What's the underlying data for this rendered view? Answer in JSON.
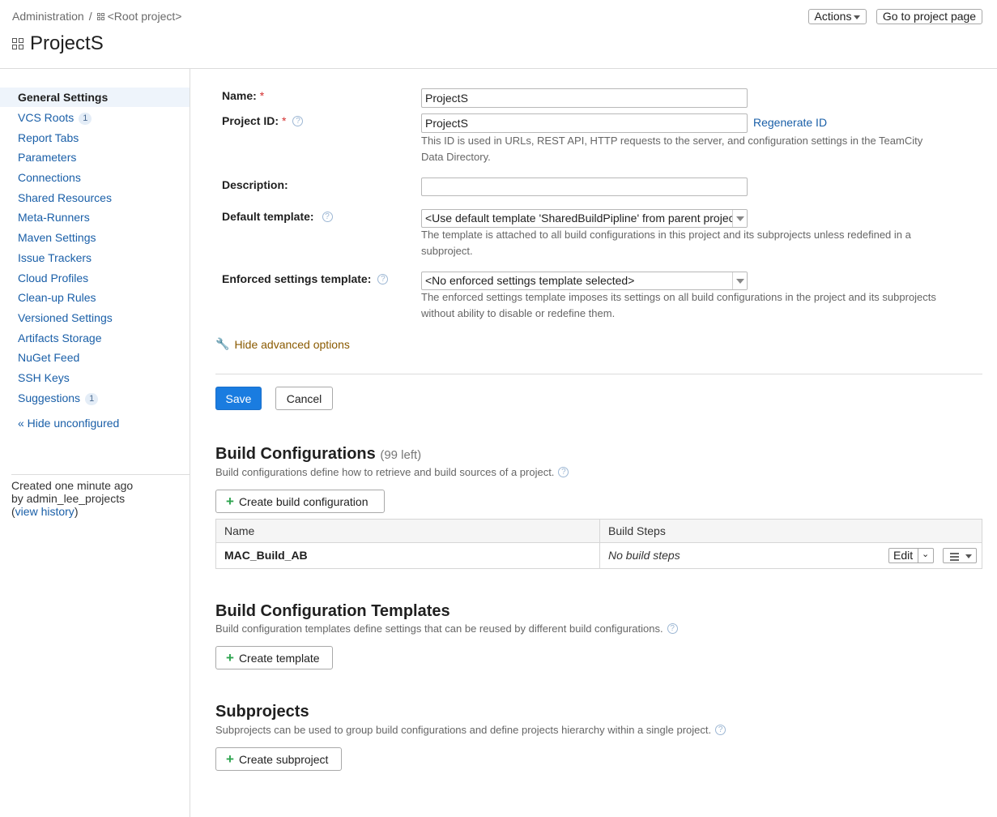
{
  "header": {
    "breadcrumb_admin": "Administration",
    "breadcrumb_sep": "/",
    "breadcrumb_root": "<Root project>",
    "title": "ProjectS",
    "actions_label": "Actions",
    "go_to_project_label": "Go to project page"
  },
  "sidebar": {
    "items": [
      {
        "label": "General Settings",
        "active": true
      },
      {
        "label": "VCS Roots",
        "badge": "1"
      },
      {
        "label": "Report Tabs"
      },
      {
        "label": "Parameters"
      },
      {
        "label": "Connections"
      },
      {
        "label": "Shared Resources"
      },
      {
        "label": "Meta-Runners"
      },
      {
        "label": "Maven Settings"
      },
      {
        "label": "Issue Trackers"
      },
      {
        "label": "Cloud Profiles"
      },
      {
        "label": "Clean-up Rules"
      },
      {
        "label": "Versioned Settings"
      },
      {
        "label": "Artifacts Storage"
      },
      {
        "label": "NuGet Feed"
      },
      {
        "label": "SSH Keys"
      },
      {
        "label": "Suggestions",
        "badge": "1"
      }
    ],
    "hide_unconfigured": "« Hide unconfigured",
    "created_line": "Created one minute ago",
    "by_line": "by admin_lee_projects",
    "history_open": "(",
    "history_link": "view history",
    "history_close": ")"
  },
  "form": {
    "name_label": "Name:",
    "name_value": "ProjectS",
    "project_id_label": "Project ID:",
    "project_id_value": "ProjectS",
    "required_mark": "*",
    "regenerate_label": "Regenerate ID",
    "project_id_note": "This ID is used in URLs, REST API, HTTP requests to the server, and configuration settings in the TeamCity Data Directory.",
    "description_label": "Description:",
    "description_value": "",
    "default_template_label": "Default template:",
    "default_template_value": "<Use default template 'SharedBuildPipline' from parent project>",
    "default_template_note": "The template is attached to all build configurations in this project and its subprojects unless redefined in a subproject.",
    "enforced_label": "Enforced settings template:",
    "enforced_value": "<No enforced settings template selected>",
    "enforced_note": "The enforced settings template imposes its settings on all build configurations in the project and its subprojects without ability to disable or redefine them.",
    "hide_advanced": "Hide advanced options",
    "save_label": "Save",
    "cancel_label": "Cancel"
  },
  "build_configurations": {
    "title": "Build Configurations",
    "left_count": "(99 left)",
    "description": "Build configurations define how to retrieve and build sources of a project.",
    "create_label": "Create build configuration",
    "columns": [
      "Name",
      "Build Steps"
    ],
    "rows": [
      {
        "name": "MAC_Build_AB",
        "steps": "No build steps",
        "edit": "Edit"
      }
    ]
  },
  "templates": {
    "title": "Build Configuration Templates",
    "description": "Build configuration templates define settings that can be reused by different build configurations.",
    "create_label": "Create template"
  },
  "subprojects": {
    "title": "Subprojects",
    "description": "Subprojects can be used to group build configurations and define projects hierarchy within a single project.",
    "create_label": "Create subproject"
  },
  "icons": {
    "help": "?",
    "plus": "+",
    "wrench": "🔧"
  },
  "colors": {
    "link": "#1a5fa8",
    "primary_button": "#1a7ce0",
    "required": "#d32f2f",
    "advanced_link": "#8a5a00"
  }
}
